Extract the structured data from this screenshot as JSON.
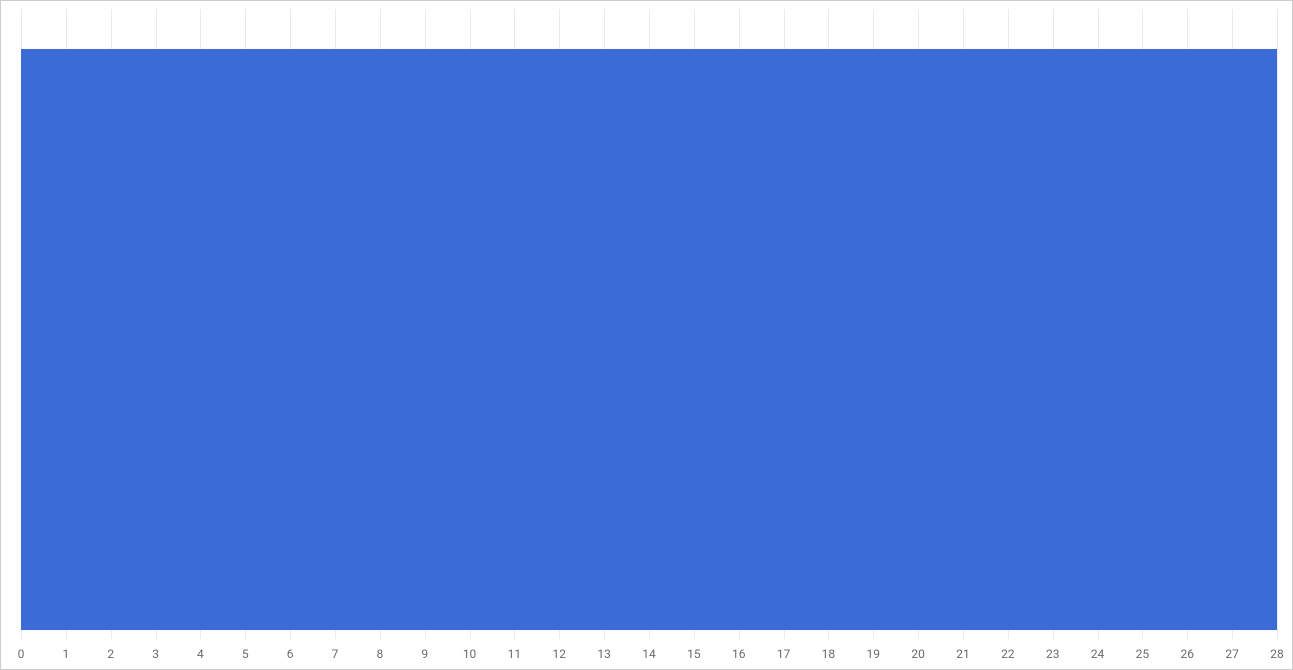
{
  "chart_data": {
    "type": "bar",
    "orientation": "horizontal",
    "categories": [
      ""
    ],
    "values": [
      28
    ],
    "xlim": [
      0,
      28
    ],
    "x_ticks": [
      0,
      1,
      2,
      3,
      4,
      5,
      6,
      7,
      8,
      9,
      10,
      11,
      12,
      13,
      14,
      15,
      16,
      17,
      18,
      19,
      20,
      21,
      22,
      23,
      24,
      25,
      26,
      27,
      28
    ],
    "bar_color": "#3a6bd6",
    "grid_color": "#ebebeb",
    "title": "",
    "xlabel": "",
    "ylabel": ""
  }
}
